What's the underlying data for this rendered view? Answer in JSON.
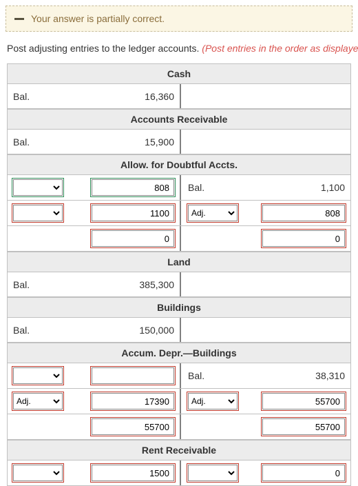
{
  "alert": {
    "text": "Your answer is partially correct."
  },
  "instruction": {
    "plain": "Post adjusting entries to the ledger accounts. ",
    "red": "(Post entries in the order as displayed in the part above,"
  },
  "labels": {
    "bal": "Bal.",
    "adj": "Adj."
  },
  "sections": {
    "cash": {
      "title": "Cash",
      "bal": "16,360"
    },
    "ar": {
      "title": "Accounts Receivable",
      "bal": "15,900"
    },
    "allow": {
      "title": "Allow. for Doubtful Accts.",
      "r1": {
        "left_sel": "",
        "left_val": "808",
        "right_label": "Bal.",
        "right_val": "1,100"
      },
      "r2": {
        "left_sel": "",
        "left_val": "1100",
        "right_sel": "Adj.",
        "right_val": "808"
      },
      "r3": {
        "left_val": "0",
        "right_val": "0"
      }
    },
    "land": {
      "title": "Land",
      "bal": "385,300"
    },
    "bldg": {
      "title": "Buildings",
      "bal": "150,000"
    },
    "accum": {
      "title": "Accum. Depr.—Buildings",
      "r1": {
        "left_sel": "",
        "left_val": "",
        "right_label": "Bal.",
        "right_val": "38,310"
      },
      "r2": {
        "left_sel": "Adj.",
        "left_val": "17390",
        "right_sel": "Adj.",
        "right_val": "55700"
      },
      "r3": {
        "left_val": "55700",
        "right_val": "55700"
      }
    },
    "rent": {
      "title": "Rent Receivable",
      "r1": {
        "left_sel": "",
        "left_val": "1500",
        "right_sel": "",
        "right_val": "0"
      }
    }
  }
}
